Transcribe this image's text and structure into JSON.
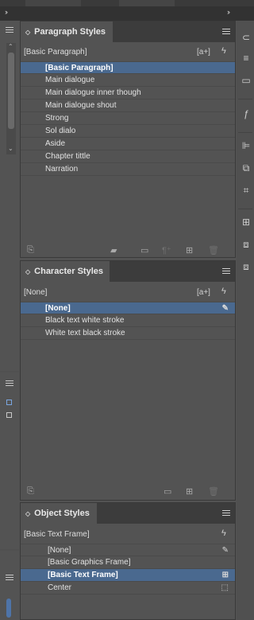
{
  "topbar": {
    "left_expand": "››",
    "right_expand": "››"
  },
  "paragraph_styles": {
    "tab_label": "Paragraph Styles",
    "current_style": "[Basic Paragraph]",
    "new_style_label": "[a+]",
    "items": [
      {
        "label": "[Basic Paragraph]",
        "selected": true
      },
      {
        "label": "Main dialogue"
      },
      {
        "label": "Main dialogue inner though"
      },
      {
        "label": "Main dialogue shout"
      },
      {
        "label": "Strong"
      },
      {
        "label": "Sol dialo"
      },
      {
        "label": "Aside"
      },
      {
        "label": "Chapter tittle"
      },
      {
        "label": "Narration"
      }
    ],
    "footer_icons": [
      "load-styles-icon",
      "folder-import-icon",
      "new-group-icon",
      "clear-overrides-icon",
      "new-style-icon",
      "delete-icon"
    ]
  },
  "character_styles": {
    "tab_label": "Character Styles",
    "current_style": "[None]",
    "new_style_label": "[a+]",
    "items": [
      {
        "label": "[None]",
        "selected": true,
        "icon": "✎"
      },
      {
        "label": "Black text white stroke"
      },
      {
        "label": "White text black stroke"
      }
    ]
  },
  "object_styles": {
    "tab_label": "Object Styles",
    "current_style": "[Basic Text Frame]",
    "items": [
      {
        "label": "[None]",
        "icon": "✎"
      },
      {
        "label": "[Basic Graphics Frame]"
      },
      {
        "label": "[Basic Text Frame]",
        "selected": true,
        "icon": "⊞"
      },
      {
        "label": "Center",
        "icon": "⬚"
      }
    ]
  },
  "colors": {
    "panel_bg": "#535353",
    "selection": "#4a698f",
    "tab_bar": "#3c3c3c"
  }
}
